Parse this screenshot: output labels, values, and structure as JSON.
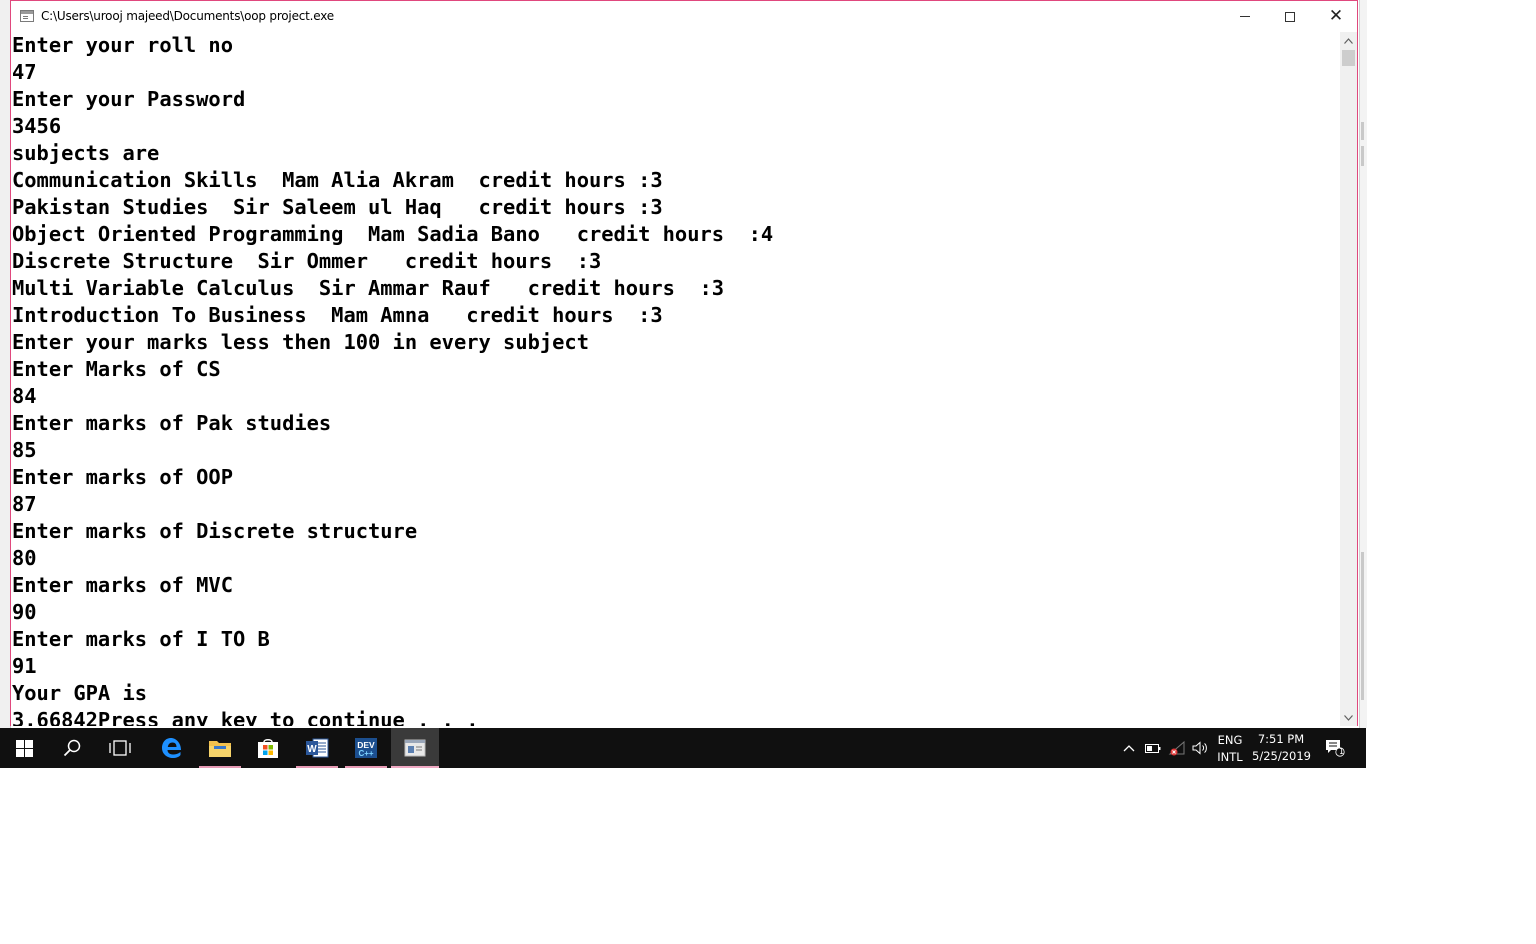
{
  "window": {
    "title": "C:\\Users\\urooj majeed\\Documents\\oop project.exe"
  },
  "console": {
    "lines": [
      "Enter your roll no",
      "47",
      "Enter your Password",
      "3456",
      "subjects are",
      "Communication Skills  Mam Alia Akram  credit hours :3",
      "Pakistan Studies  Sir Saleem ul Haq   credit hours :3",
      "Object Oriented Programming  Mam Sadia Bano   credit hours  :4",
      "Discrete Structure  Sir Ommer   credit hours  :3",
      "Multi Variable Calculus  Sir Ammar Rauf   credit hours  :3",
      "Introduction To Business  Mam Amna   credit hours  :3",
      "Enter your marks less then 100 in every subject",
      "Enter Marks of CS",
      "84",
      "Enter marks of Pak studies",
      "85",
      "Enter marks of OOP",
      "87",
      "Enter marks of Discrete structure",
      "80",
      "Enter marks of MVC",
      "90",
      "Enter marks of I TO B",
      "91",
      "Your GPA is",
      "3.66842Press any key to continue . . ."
    ]
  },
  "taskbar": {
    "apps": [
      {
        "icon": "windows-start-icon"
      },
      {
        "icon": "search-icon"
      },
      {
        "icon": "task-view-icon"
      },
      {
        "icon": "edge-icon"
      },
      {
        "icon": "file-explorer-icon"
      },
      {
        "icon": "store-icon"
      },
      {
        "icon": "word-icon"
      },
      {
        "icon": "devcpp-icon"
      },
      {
        "icon": "console-app-icon"
      }
    ],
    "tray": {
      "language_top": "ENG",
      "language_bottom": "INTL",
      "time": "7:51 PM",
      "date": "5/25/2019",
      "notification_count": "1"
    }
  },
  "colors": {
    "window_border": "#e0487d",
    "taskbar_bg": "#101010",
    "console_text": "#000000",
    "console_bg": "#ffffff"
  }
}
